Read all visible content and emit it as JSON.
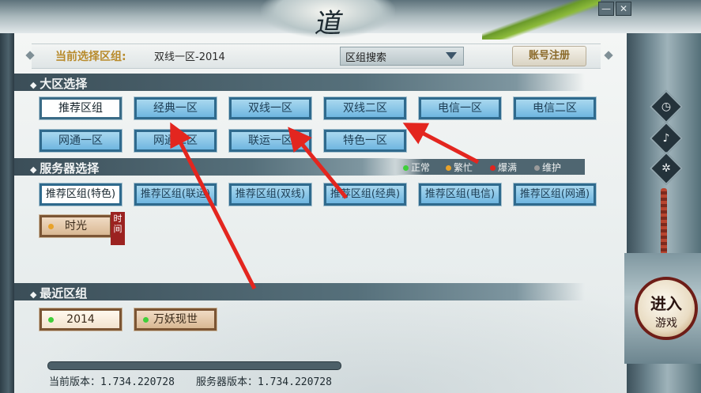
{
  "title_glyph": "道",
  "window_controls": {
    "minimize": "—",
    "close": "✕"
  },
  "header": {
    "current_label": "当前选择区组:",
    "current_value": "双线一区-2014",
    "search_label": "区组搜索",
    "register_label": "账号注册"
  },
  "zone_section": {
    "title": "大区选择",
    "zones": [
      "推荐区组",
      "经典一区",
      "双线一区",
      "双线二区",
      "电信一区",
      "电信二区",
      "网通一区",
      "网通二区",
      "联运一区",
      "特色一区"
    ],
    "selected_index": 0
  },
  "server_section": {
    "title": "服务器选择",
    "legend": [
      {
        "label": "正常",
        "color": "#3fcf3a"
      },
      {
        "label": "繁忙",
        "color": "#e8a22a"
      },
      {
        "label": "爆满",
        "color": "#e0251f"
      },
      {
        "label": "维护",
        "color": "#9a9a9a"
      }
    ],
    "servers": [
      "推荐区组(特色)",
      "推荐区组(联运)",
      "推荐区组(双线)",
      "推荐区组(经典)",
      "推荐区组(电信)",
      "推荐区组(网通)"
    ],
    "selected_index": 0,
    "special_server": {
      "label": "时光",
      "status_color": "#e8a22a",
      "tag": "时间"
    }
  },
  "recent_section": {
    "title": "最近区组",
    "items": [
      {
        "label": "2014",
        "status_color": "#3fcf3a"
      },
      {
        "label": "万妖现世",
        "status_color": "#3fcf3a"
      }
    ]
  },
  "footer": {
    "client_version": "当前版本：1.734.220728",
    "server_version": "服务器版本：1.734.220728"
  },
  "enter_button": {
    "line1": "进入",
    "line2": "游戏"
  },
  "side_tools": [
    "clock-icon",
    "microphone-icon",
    "settings-icon"
  ],
  "accent_colors": {
    "arrow": "#e3261f",
    "zone_button": "#6fb6e0",
    "gold_label": "#b88b2c"
  }
}
